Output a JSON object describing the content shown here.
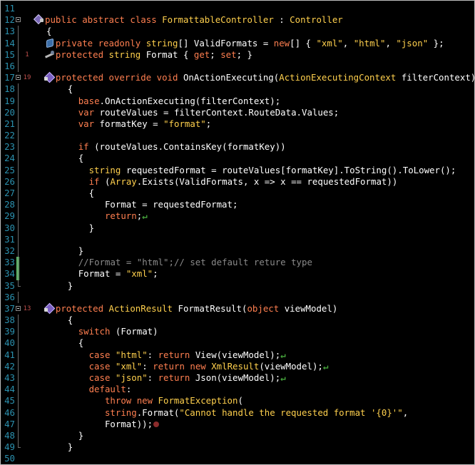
{
  "editor": {
    "lines": [
      {
        "n": "11",
        "tokens": []
      },
      {
        "n": "12",
        "fold": "box",
        "icon": "cube",
        "tokens": [
          {
            "t": "public abstract class ",
            "c": "kw"
          },
          {
            "t": "FormattableController",
            "c": "ty"
          },
          {
            "t": " : ",
            "c": "tx"
          },
          {
            "t": "Controller",
            "c": "ty"
          }
        ]
      },
      {
        "n": "13",
        "fold": "line",
        "tokens": [
          {
            "t": "{",
            "c": "tx"
          }
        ]
      },
      {
        "n": "14",
        "fold": "line",
        "icon": "field",
        "indent": 2,
        "tokens": [
          {
            "t": "private readonly ",
            "c": "kw"
          },
          {
            "t": "string",
            "c": "ty"
          },
          {
            "t": "[] ValidFormats = ",
            "c": "tx"
          },
          {
            "t": "new",
            "c": "kw"
          },
          {
            "t": "[] { ",
            "c": "tx"
          },
          {
            "t": "\"xml\"",
            "c": "st"
          },
          {
            "t": ", ",
            "c": "tx"
          },
          {
            "t": "\"html\"",
            "c": "st"
          },
          {
            "t": ", ",
            "c": "tx"
          },
          {
            "t": "\"json\"",
            "c": "st"
          },
          {
            "t": " };",
            "c": "tx"
          }
        ]
      },
      {
        "n": "15",
        "fold": "line",
        "icon": "wrench",
        "mark": "1",
        "indent": 2,
        "tokens": [
          {
            "t": "protected ",
            "c": "kw"
          },
          {
            "t": "string",
            "c": "ty"
          },
          {
            "t": " Format { ",
            "c": "tx"
          },
          {
            "t": "get",
            "c": "kw"
          },
          {
            "t": "; ",
            "c": "tx"
          },
          {
            "t": "set",
            "c": "kw"
          },
          {
            "t": "; }",
            "c": "tx"
          }
        ]
      },
      {
        "n": "16",
        "fold": "line",
        "tokens": []
      },
      {
        "n": "17",
        "fold": "box",
        "icon": "method",
        "mark": "19",
        "indent": 2,
        "tokens": [
          {
            "t": "protected override void ",
            "c": "kw"
          },
          {
            "t": "OnActionExecuting",
            "c": "tx"
          },
          {
            "t": "(",
            "c": "tx"
          },
          {
            "t": "ActionExecutingContext",
            "c": "ty"
          },
          {
            "t": " filterContext)",
            "c": "tx"
          }
        ]
      },
      {
        "n": "18",
        "fold": "line",
        "indent": 4,
        "tokens": [
          {
            "t": "{",
            "c": "tx"
          }
        ]
      },
      {
        "n": "19",
        "fold": "line",
        "indent": 6,
        "tokens": [
          {
            "t": "base",
            "c": "kw"
          },
          {
            "t": ".OnActionExecuting(filterContext);",
            "c": "tx"
          }
        ]
      },
      {
        "n": "20",
        "fold": "line",
        "indent": 6,
        "tokens": [
          {
            "t": "var",
            "c": "kw"
          },
          {
            "t": " routeValues = filterContext.RouteData.Values;",
            "c": "tx"
          }
        ]
      },
      {
        "n": "21",
        "fold": "line",
        "indent": 6,
        "tokens": [
          {
            "t": "var",
            "c": "kw"
          },
          {
            "t": " formatKey = ",
            "c": "tx"
          },
          {
            "t": "\"format\"",
            "c": "st"
          },
          {
            "t": ";",
            "c": "tx"
          }
        ]
      },
      {
        "n": "22",
        "fold": "line",
        "tokens": []
      },
      {
        "n": "23",
        "fold": "line",
        "indent": 6,
        "tokens": [
          {
            "t": "if",
            "c": "kw"
          },
          {
            "t": " (routeValues.ContainsKey(formatKey))",
            "c": "tx"
          }
        ]
      },
      {
        "n": "24",
        "fold": "line",
        "indent": 6,
        "tokens": [
          {
            "t": "{",
            "c": "tx"
          }
        ]
      },
      {
        "n": "25",
        "fold": "line",
        "indent": 8,
        "tokens": [
          {
            "t": "string",
            "c": "ty"
          },
          {
            "t": " requestedFormat = routeValues[formatKey].ToString().ToLower();",
            "c": "tx"
          }
        ]
      },
      {
        "n": "26",
        "fold": "line",
        "indent": 8,
        "tokens": [
          {
            "t": "if",
            "c": "kw"
          },
          {
            "t": " (",
            "c": "tx"
          },
          {
            "t": "Array",
            "c": "ty"
          },
          {
            "t": ".Exists(ValidFormats, x => x == requestedFormat))",
            "c": "tx"
          }
        ]
      },
      {
        "n": "27",
        "fold": "line",
        "indent": 8,
        "tokens": [
          {
            "t": "{",
            "c": "tx"
          }
        ]
      },
      {
        "n": "28",
        "fold": "line",
        "indent": 11,
        "tokens": [
          {
            "t": "Format = requestedFormat;",
            "c": "tx"
          }
        ]
      },
      {
        "n": "29",
        "fold": "line",
        "indent": 11,
        "ret": true,
        "tokens": [
          {
            "t": "return",
            "c": "kw"
          },
          {
            "t": ";",
            "c": "tx"
          }
        ]
      },
      {
        "n": "30",
        "fold": "line",
        "indent": 8,
        "tokens": [
          {
            "t": "}",
            "c": "tx"
          }
        ]
      },
      {
        "n": "31",
        "fold": "line",
        "tokens": []
      },
      {
        "n": "32",
        "fold": "line",
        "indent": 6,
        "tokens": [
          {
            "t": "}",
            "c": "tx"
          }
        ]
      },
      {
        "n": "33",
        "fold": "line",
        "bar": "#5fbf6a",
        "indent": 6,
        "tokens": [
          {
            "t": "//Format = \"html\";// set default reture type",
            "c": "cm"
          }
        ]
      },
      {
        "n": "34",
        "fold": "line",
        "bar": "#5fbf6a",
        "indent": 6,
        "tokens": [
          {
            "t": "Format = ",
            "c": "tx"
          },
          {
            "t": "\"xml\"",
            "c": "st"
          },
          {
            "t": ";",
            "c": "tx"
          }
        ]
      },
      {
        "n": "35",
        "fold": "end",
        "indent": 4,
        "tokens": [
          {
            "t": "}",
            "c": "tx"
          }
        ]
      },
      {
        "n": "36",
        "fold": "line",
        "tokens": []
      },
      {
        "n": "37",
        "fold": "box",
        "icon": "method",
        "mark": "13",
        "indent": 2,
        "tokens": [
          {
            "t": "protected ",
            "c": "kw"
          },
          {
            "t": "ActionResult",
            "c": "ty"
          },
          {
            "t": " FormatResult(",
            "c": "tx"
          },
          {
            "t": "object",
            "c": "kw"
          },
          {
            "t": " viewModel)",
            "c": "tx"
          }
        ]
      },
      {
        "n": "38",
        "fold": "line",
        "indent": 4,
        "tokens": [
          {
            "t": "{",
            "c": "tx"
          }
        ]
      },
      {
        "n": "39",
        "fold": "line",
        "indent": 6,
        "tokens": [
          {
            "t": "switch",
            "c": "kw"
          },
          {
            "t": " (Format)",
            "c": "tx"
          }
        ]
      },
      {
        "n": "40",
        "fold": "line",
        "indent": 6,
        "tokens": [
          {
            "t": "{",
            "c": "tx"
          }
        ]
      },
      {
        "n": "41",
        "fold": "line",
        "indent": 8,
        "ret": true,
        "tokens": [
          {
            "t": "case ",
            "c": "kw"
          },
          {
            "t": "\"html\"",
            "c": "st"
          },
          {
            "t": ": ",
            "c": "tx"
          },
          {
            "t": "return ",
            "c": "kw"
          },
          {
            "t": "View(viewModel);",
            "c": "tx"
          }
        ]
      },
      {
        "n": "42",
        "fold": "line",
        "indent": 8,
        "ret": true,
        "tokens": [
          {
            "t": "case ",
            "c": "kw"
          },
          {
            "t": "\"xml\"",
            "c": "st"
          },
          {
            "t": ": ",
            "c": "tx"
          },
          {
            "t": "return new ",
            "c": "kw"
          },
          {
            "t": "XmlResult",
            "c": "ty"
          },
          {
            "t": "(viewModel);",
            "c": "tx"
          }
        ]
      },
      {
        "n": "43",
        "fold": "line",
        "indent": 8,
        "ret": true,
        "tokens": [
          {
            "t": "case ",
            "c": "kw"
          },
          {
            "t": "\"json\"",
            "c": "st"
          },
          {
            "t": ": ",
            "c": "tx"
          },
          {
            "t": "return ",
            "c": "kw"
          },
          {
            "t": "Json(viewModel);",
            "c": "tx"
          }
        ]
      },
      {
        "n": "44",
        "fold": "line",
        "indent": 8,
        "tokens": [
          {
            "t": "default",
            "c": "kw"
          },
          {
            "t": ":",
            "c": "tx"
          }
        ]
      },
      {
        "n": "45",
        "fold": "line",
        "indent": 11,
        "tokens": [
          {
            "t": "throw new ",
            "c": "kw"
          },
          {
            "t": "FormatException",
            "c": "ty"
          },
          {
            "t": "(",
            "c": "tx"
          }
        ]
      },
      {
        "n": "46",
        "fold": "line",
        "indent": 11,
        "tokens": [
          {
            "t": "string",
            "c": "kw"
          },
          {
            "t": ".Format(",
            "c": "tx"
          },
          {
            "t": "\"Cannot handle the requested format '{0}'\"",
            "c": "st"
          },
          {
            "t": ",",
            "c": "tx"
          }
        ]
      },
      {
        "n": "47",
        "fold": "line",
        "indent": 11,
        "bp": true,
        "tokens": [
          {
            "t": "Format));",
            "c": "tx"
          }
        ]
      },
      {
        "n": "48",
        "fold": "line",
        "indent": 6,
        "tokens": [
          {
            "t": "}",
            "c": "tx"
          }
        ]
      },
      {
        "n": "49",
        "fold": "end",
        "indent": 4,
        "tokens": [
          {
            "t": "}",
            "c": "tx"
          }
        ]
      },
      {
        "n": "50",
        "tokens": []
      }
    ]
  }
}
